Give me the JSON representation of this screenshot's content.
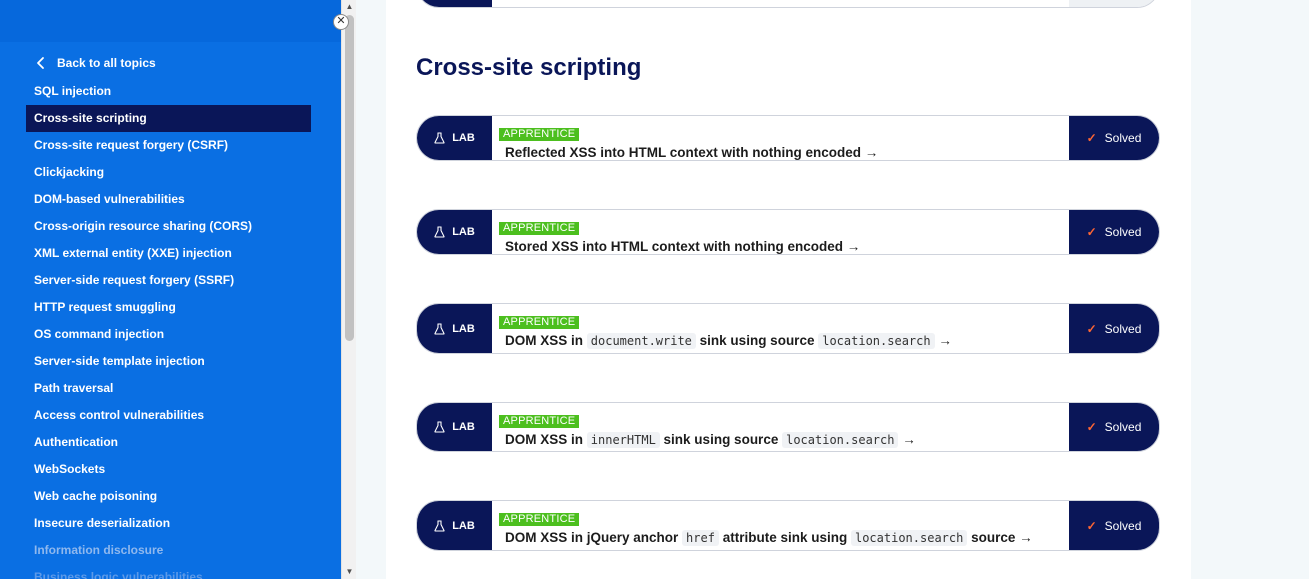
{
  "sidebar": {
    "close_glyph": "✕",
    "back_label": "Back to all topics",
    "items": [
      {
        "label": "SQL injection"
      },
      {
        "label": "Cross-site scripting"
      },
      {
        "label": "Cross-site request forgery (CSRF)"
      },
      {
        "label": "Clickjacking"
      },
      {
        "label": "DOM-based vulnerabilities"
      },
      {
        "label": "Cross-origin resource sharing (CORS)"
      },
      {
        "label": "XML external entity (XXE) injection"
      },
      {
        "label": "Server-side request forgery (SSRF)"
      },
      {
        "label": "HTTP request smuggling"
      },
      {
        "label": "OS command injection"
      },
      {
        "label": "Server-side template injection"
      },
      {
        "label": "Path traversal"
      },
      {
        "label": "Access control vulnerabilities"
      },
      {
        "label": "Authentication"
      },
      {
        "label": "WebSockets"
      },
      {
        "label": "Web cache poisoning"
      },
      {
        "label": "Insecure deserialization"
      },
      {
        "label": "Information disclosure"
      },
      {
        "label": "Business logic vulnerabilities"
      }
    ],
    "active_item": "Cross-site scripting"
  },
  "main": {
    "heading": "Cross-site scripting",
    "labs": [
      {
        "tag": "LAB",
        "level": "APPRENTICE",
        "title_parts": [
          "Reflected XSS into HTML context with nothing encoded →"
        ],
        "status": "Solved"
      },
      {
        "tag": "LAB",
        "level": "APPRENTICE",
        "title_parts": [
          "Stored XSS into HTML context with nothing encoded →"
        ],
        "status": "Solved"
      },
      {
        "tag": "LAB",
        "level": "APPRENTICE",
        "title_parts": [
          "DOM XSS in ",
          "document.write",
          " sink using source ",
          "location.search",
          " →"
        ],
        "status": "Solved"
      },
      {
        "tag": "LAB",
        "level": "APPRENTICE",
        "title_parts": [
          "DOM XSS in ",
          "innerHTML",
          " sink using source ",
          "location.search",
          " →"
        ],
        "status": "Solved"
      },
      {
        "tag": "LAB",
        "level": "APPRENTICE",
        "title_parts": [
          "DOM XSS in jQuery anchor ",
          "href",
          " attribute sink using ",
          "location.search",
          " source →"
        ],
        "status": "Solved"
      }
    ]
  },
  "colors": {
    "sidebar_bg": "#0a6fe3",
    "navy": "#0a1658",
    "badge_green": "#4cbf1e",
    "check_orange": "#ff6633"
  },
  "icons": {
    "back": "chevron-left-icon",
    "lab": "flask-icon",
    "solved": "checkmark-icon",
    "close": "close-icon"
  }
}
